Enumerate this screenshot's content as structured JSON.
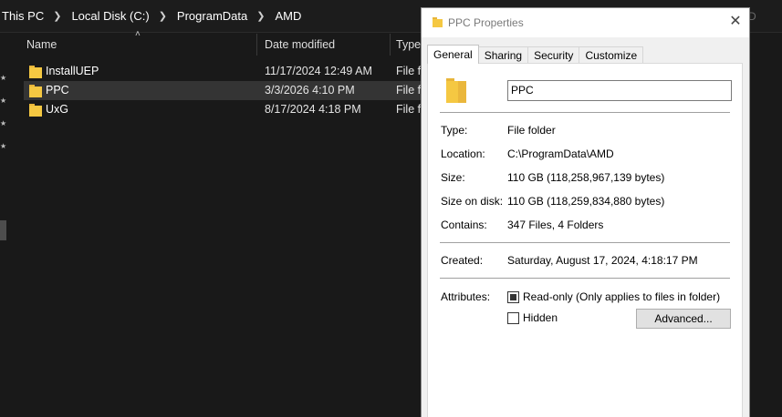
{
  "explorer": {
    "breadcrumb": [
      "This PC",
      "Local Disk (C:)",
      "ProgramData",
      "AMD"
    ],
    "ghost_search_text": "D",
    "columns": {
      "name": "Name",
      "date": "Date modified",
      "type": "Type"
    },
    "rows": [
      {
        "name": "InstallUEP",
        "date": "11/17/2024 12:49 AM",
        "type": "File fo"
      },
      {
        "name": "PPC",
        "date": "3/3/2026 4:10 PM",
        "type": "File fo",
        "selected": true
      },
      {
        "name": "UxG",
        "date": "8/17/2024 4:18 PM",
        "type": "File fo"
      }
    ]
  },
  "dialog": {
    "title": "PPC Properties",
    "close_glyph": "✕",
    "tabs": [
      "General",
      "Sharing",
      "Security",
      "Customize"
    ],
    "active_tab": "General",
    "folder_name": "PPC",
    "labels": {
      "type": "Type:",
      "location": "Location:",
      "size": "Size:",
      "size_on_disk": "Size on disk:",
      "contains": "Contains:",
      "created": "Created:",
      "attributes": "Attributes:"
    },
    "values": {
      "type": "File folder",
      "location": "C:\\ProgramData\\AMD",
      "size": "110 GB (118,258,967,139 bytes)",
      "size_on_disk": "110 GB (118,259,834,880 bytes)",
      "contains": "347 Files, 4 Folders",
      "created": "Saturday, August 17, 2024, 4:18:17 PM"
    },
    "attributes": {
      "readonly_label": "Read-only (Only applies to files in folder)",
      "readonly_state": "indeterminate",
      "hidden_label": "Hidden",
      "hidden_checked": false,
      "advanced_button": "Advanced..."
    }
  },
  "colors": {
    "explorer_bg": "#191919",
    "selected_row": "#343434",
    "folder_yellow": "#f5c842",
    "dialog_bg": "#f0f0f0"
  }
}
